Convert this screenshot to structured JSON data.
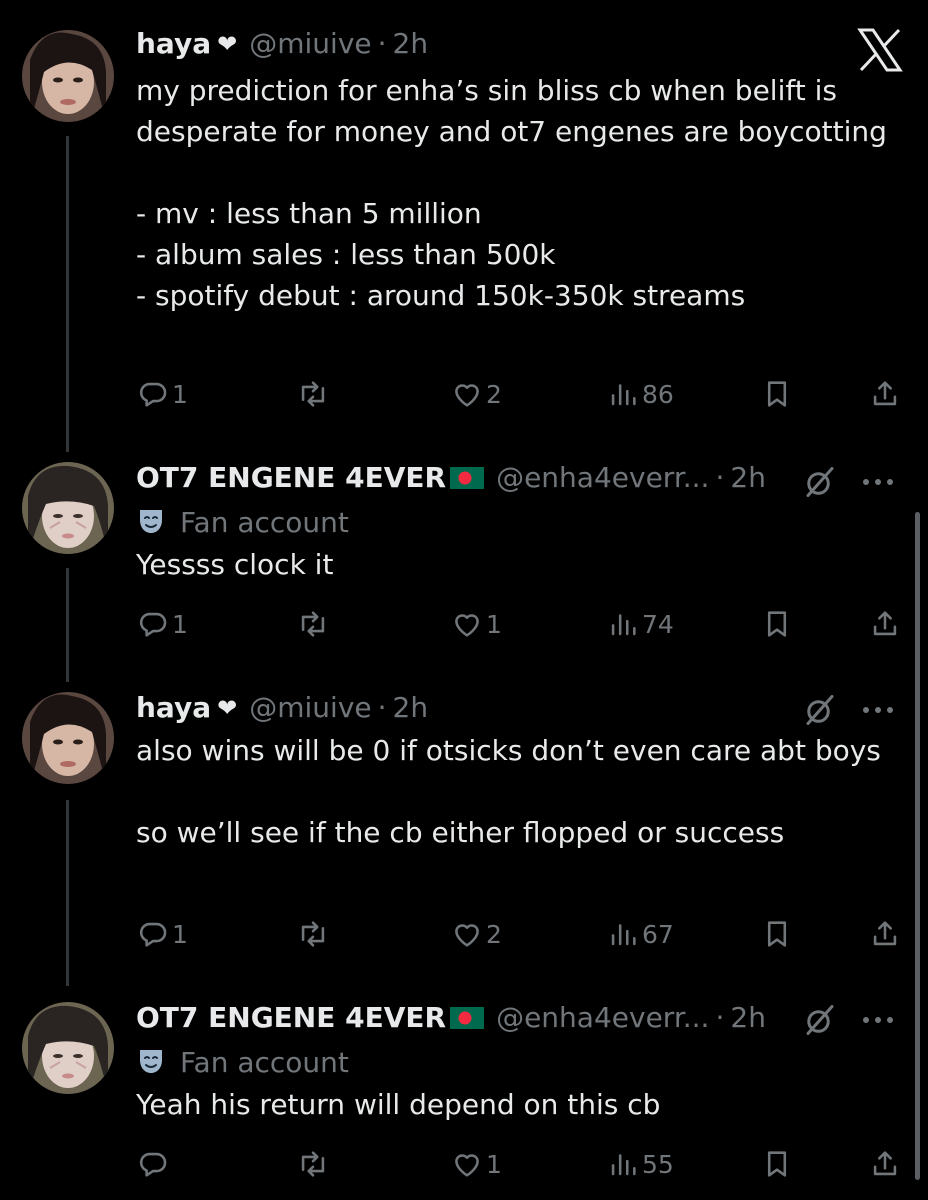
{
  "app": {
    "logo": "x-logo",
    "logo_icon": "x-icon"
  },
  "tweets": [
    {
      "author": "haya",
      "badge": "heart",
      "handle": "@miuive",
      "time": "2h",
      "text": "my prediction for enha’s sin bliss cb when belift is desperate for money and ot7 engenes are boycotting\n\n- mv : less than 5 million\n- album sales : less than 500k\n- spotify debut : around 150k-350k streams",
      "replies": "1",
      "retweets": "",
      "likes": "2",
      "views": "86"
    },
    {
      "author": "OT7 ENGENE 4EVER",
      "flag": "bangladesh-flag",
      "handle": "@enha4everr...",
      "time": "2h",
      "fan_label": "Fan account",
      "text": "Yessss clock it",
      "replies": "1",
      "retweets": "",
      "likes": "1",
      "views": "74"
    },
    {
      "author": "haya",
      "badge": "heart",
      "handle": "@miuive",
      "time": "2h",
      "text": "also wins will be 0 if otsicks don’t even care abt boys\n\nso we’ll see if the cb either flopped or success",
      "replies": "1",
      "retweets": "",
      "likes": "2",
      "views": "67"
    },
    {
      "author": "OT7 ENGENE 4EVER",
      "flag": "bangladesh-flag",
      "handle": "@enha4everr...",
      "time": "2h",
      "fan_label": "Fan account",
      "text": "Yeah his return will depend on this cb",
      "replies": "",
      "retweets": "",
      "likes": "1",
      "views": "55"
    }
  ],
  "colors": {
    "background": "#000000",
    "text": "#e7e9ea",
    "secondary": "#71767b",
    "thread_line": "#333639",
    "flag_green": "#006a4e",
    "flag_red": "#f42a41"
  }
}
